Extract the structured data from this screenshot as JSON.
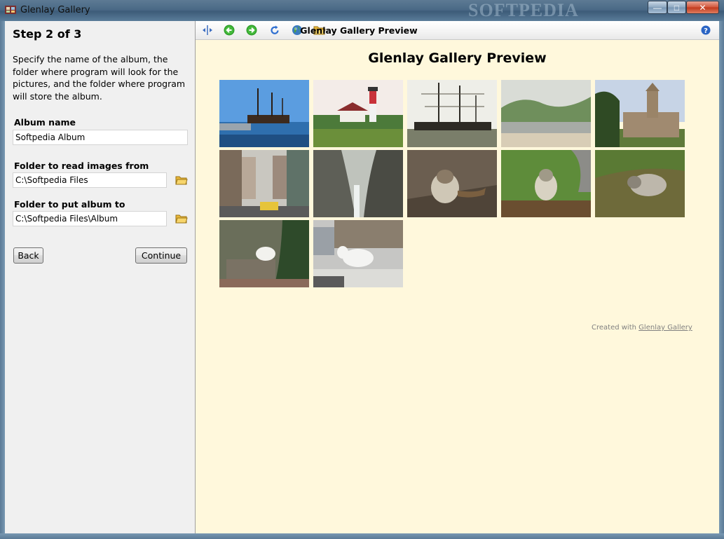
{
  "window": {
    "title": "Glenlay Gallery",
    "watermark": "SOFTPEDIA",
    "controls": {
      "minimize": "—",
      "maximize": "□",
      "close": "✕"
    }
  },
  "wizard": {
    "step_title": "Step 2 of 3",
    "description": "Specify the name of the album, the folder where program will look for the pictures, and the folder where program will store the album.",
    "fields": {
      "album_name": {
        "label": "Album name",
        "value": "Softpedia Album"
      },
      "read_folder": {
        "label": "Folder to read images from",
        "value": "C:\\Softpedia Files"
      },
      "album_folder": {
        "label": "Folder to put album to",
        "value": "C:\\Softpedia Files\\Album"
      }
    },
    "buttons": {
      "back": "Back",
      "continue": "Continue"
    }
  },
  "preview": {
    "toolbar_title": "Glenlay Gallery Preview",
    "toolbar_icons": [
      "split-view-icon",
      "back-arrow-icon",
      "forward-arrow-icon",
      "refresh-icon",
      "globe-icon",
      "open-folder-icon",
      "help-icon"
    ],
    "page_title": "Glenlay Gallery Preview",
    "credit_prefix": "Created with",
    "credit_link": "Glenlay Gallery"
  },
  "colors": {
    "preview_background": "#fff8dc",
    "panel_background": "#f0f0f0",
    "nav_green": "#2f9e2a"
  }
}
